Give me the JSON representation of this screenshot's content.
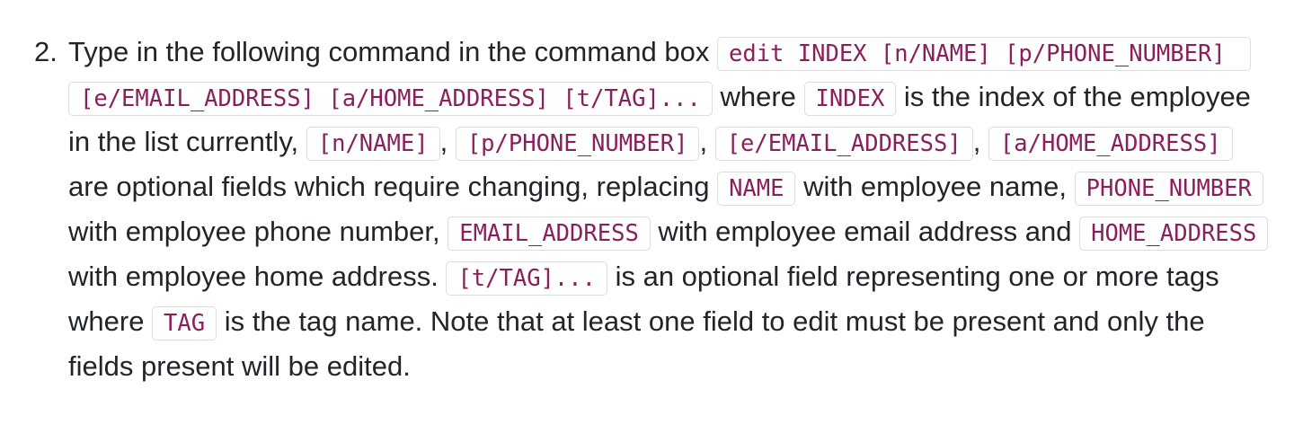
{
  "step": {
    "number": "2.",
    "segments": [
      {
        "type": "text",
        "value": "Type in the following command in the command box "
      },
      {
        "type": "code",
        "value": "edit INDEX [n/NAME] [p/PHONE_NUMBER] [e/EMAIL_ADDRESS] [a/HOME_ADDRESS] [t/TAG]..."
      },
      {
        "type": "text",
        "value": " where "
      },
      {
        "type": "code",
        "value": "INDEX"
      },
      {
        "type": "text",
        "value": " is the index of the employee in the list currently, "
      },
      {
        "type": "code",
        "value": "[n/NAME]"
      },
      {
        "type": "text",
        "value": ", "
      },
      {
        "type": "code",
        "value": "[p/PHONE_NUMBER]"
      },
      {
        "type": "text",
        "value": ", "
      },
      {
        "type": "code",
        "value": "[e/EMAIL_ADDRESS]"
      },
      {
        "type": "text",
        "value": ", "
      },
      {
        "type": "code",
        "value": "[a/HOME_ADDRESS]"
      },
      {
        "type": "text",
        "value": " are optional fields which require changing, replacing "
      },
      {
        "type": "code",
        "value": "NAME"
      },
      {
        "type": "text",
        "value": " with employee name, "
      },
      {
        "type": "code",
        "value": "PHONE_NUMBER"
      },
      {
        "type": "text",
        "value": " with employee phone number, "
      },
      {
        "type": "code",
        "value": "EMAIL_ADDRESS"
      },
      {
        "type": "text",
        "value": " with employee email address and "
      },
      {
        "type": "code",
        "value": "HOME_ADDRESS"
      },
      {
        "type": "text",
        "value": " with employee home address. "
      },
      {
        "type": "code",
        "value": "[t/TAG]..."
      },
      {
        "type": "text",
        "value": " is an optional field representing one or more tags where "
      },
      {
        "type": "code",
        "value": "TAG"
      },
      {
        "type": "text",
        "value": " is the tag name. Note that at least one field to edit must be present and only the fields present will be edited."
      }
    ]
  },
  "colors": {
    "text": "#212529",
    "code_text": "#8b1f5c",
    "code_border": "#dcdcdc"
  }
}
